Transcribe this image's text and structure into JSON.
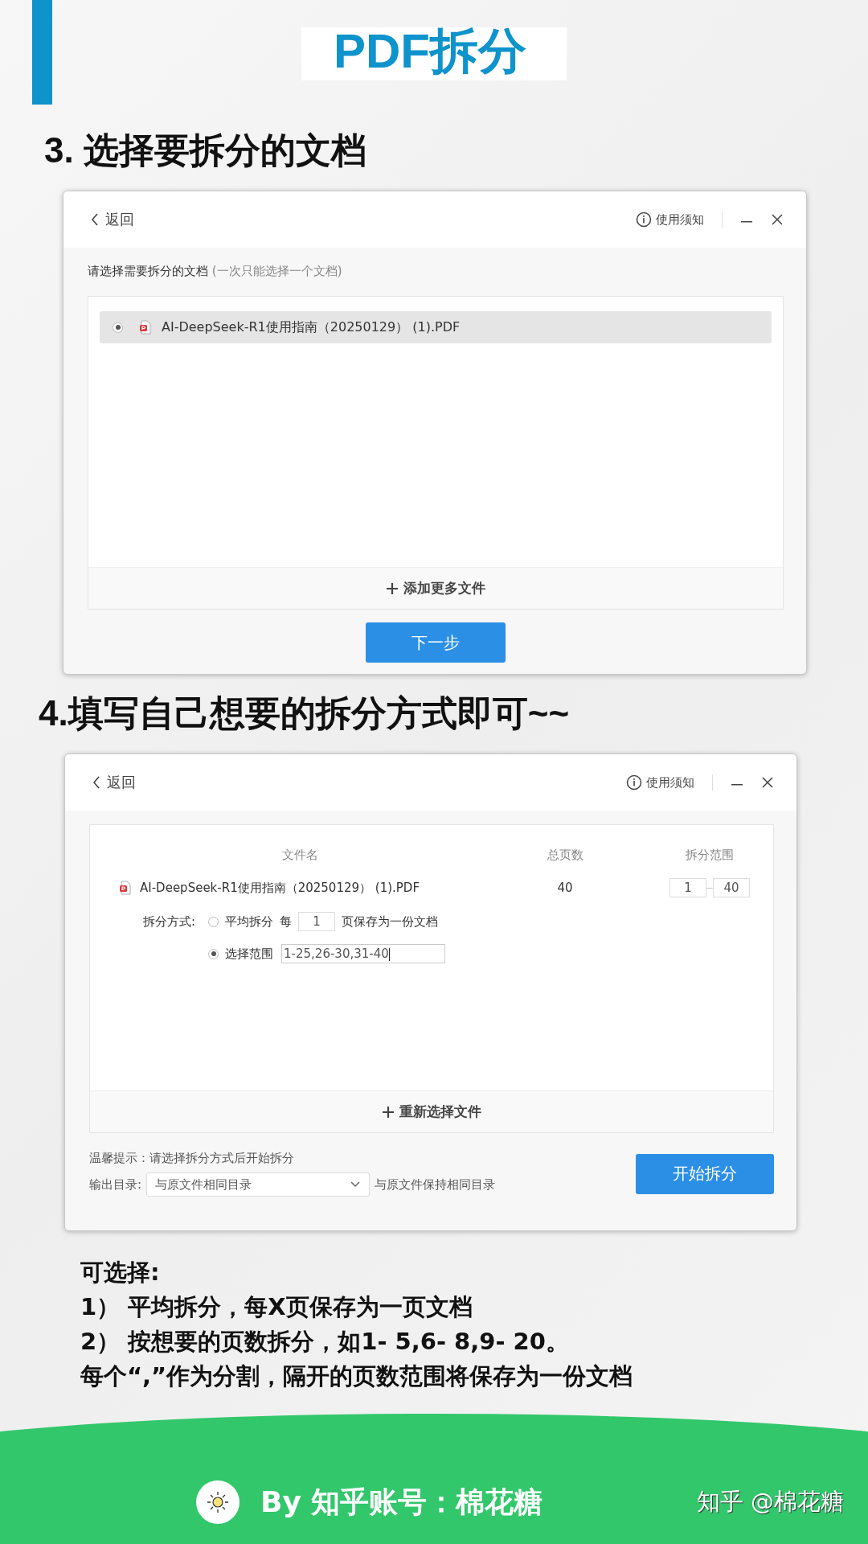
{
  "header": {
    "title": "PDF拆分"
  },
  "step3": {
    "heading": "3. 选择要拆分的文档",
    "dialog": {
      "back": "返回",
      "notice": "使用须知",
      "prompt": "请选择需要拆分的文档",
      "prompt_hint": "(一次只能选择一个文档)",
      "files": [
        {
          "name": "AI-DeepSeek-R1使用指南（20250129） (1).PDF",
          "selected": true
        }
      ],
      "add_more": "添加更多文件",
      "next": "下一步"
    }
  },
  "step4": {
    "heading": "4.填写自己想要的拆分方式即可~~",
    "dialog": {
      "back": "返回",
      "notice": "使用须知",
      "columns": [
        "文件名",
        "总页数",
        "拆分范围"
      ],
      "file": {
        "name": "AI-DeepSeek-R1使用指南（20250129） (1).PDF",
        "pages": "40",
        "range_from": "1",
        "range_to": "40"
      },
      "method_label": "拆分方式:",
      "methods": [
        {
          "kind": "even",
          "label": "平均拆分",
          "prefix": "每",
          "value": "1",
          "suffix": "页保存为一份文档",
          "selected": false
        },
        {
          "kind": "range",
          "label": "选择范围",
          "value": "1-25,26-30,31-40",
          "selected": true
        }
      ],
      "reselect": "重新选择文件",
      "tip": "温馨提示：请选择拆分方式后开始拆分",
      "output_label": "输出目录:",
      "output_value": "与原文件相同目录",
      "output_hint": "与原文件保持相同目录",
      "start": "开始拆分"
    }
  },
  "notes": [
    "可选择:",
    "1）  平均拆分，每X页保存为一页文档",
    "2）  按想要的页数拆分，如1- 5,6- 8,9- 20。",
    "每个“,”作为分割，隔开的页数范围将保存为一份文档"
  ],
  "footer": {
    "byline": "By  知乎账号：棉花糖",
    "watermark_site": "知乎 @棉花糖"
  }
}
